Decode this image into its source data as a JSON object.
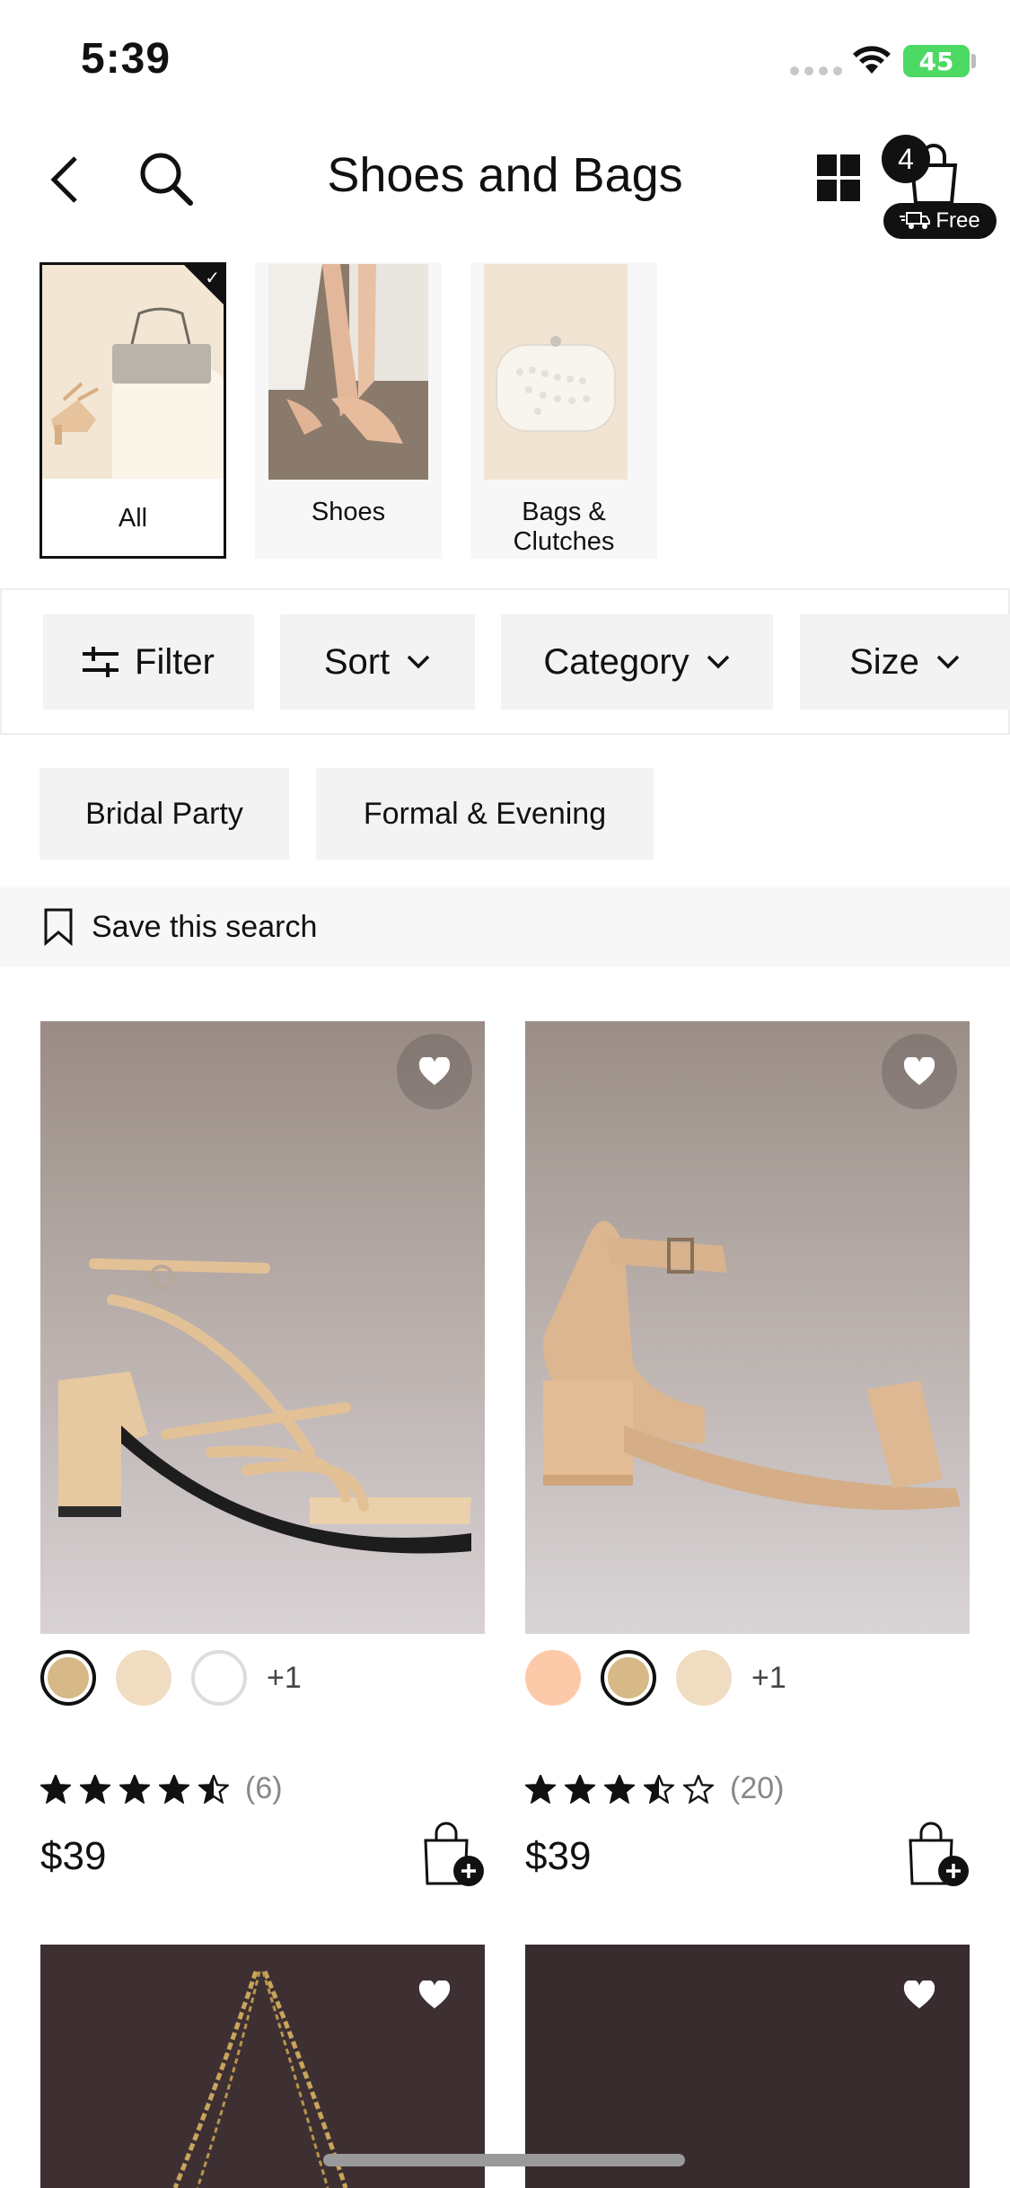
{
  "status": {
    "time": "5:39",
    "battery": "45"
  },
  "header": {
    "title": "Shoes and Bags",
    "cart_count": "4",
    "free_label": "Free"
  },
  "categories": [
    {
      "label": "All",
      "selected": true
    },
    {
      "label": "Shoes",
      "selected": false
    },
    {
      "label": "Bags & Clutches",
      "selected": false
    }
  ],
  "filters": {
    "filter": "Filter",
    "sort": "Sort",
    "category": "Category",
    "size": "Size"
  },
  "tags": [
    "Bridal Party",
    "Formal & Evening"
  ],
  "save_search": "Save this search",
  "products": [
    {
      "swatches": [
        "#d7b987",
        "#f0dcc0",
        "#ffffff"
      ],
      "selected_swatch": 0,
      "more": "+1",
      "rating": 4.5,
      "reviews": "(6)",
      "price": "$39"
    },
    {
      "swatches": [
        "#fcc9a9",
        "#d7b987",
        "#f0dcc0"
      ],
      "selected_swatch": 1,
      "more": "+1",
      "rating": 3.5,
      "reviews": "(20)",
      "price": "$39"
    }
  ],
  "colors": {
    "accent": "#111111",
    "chip_bg": "#f3f3f3",
    "star": "#111111"
  }
}
